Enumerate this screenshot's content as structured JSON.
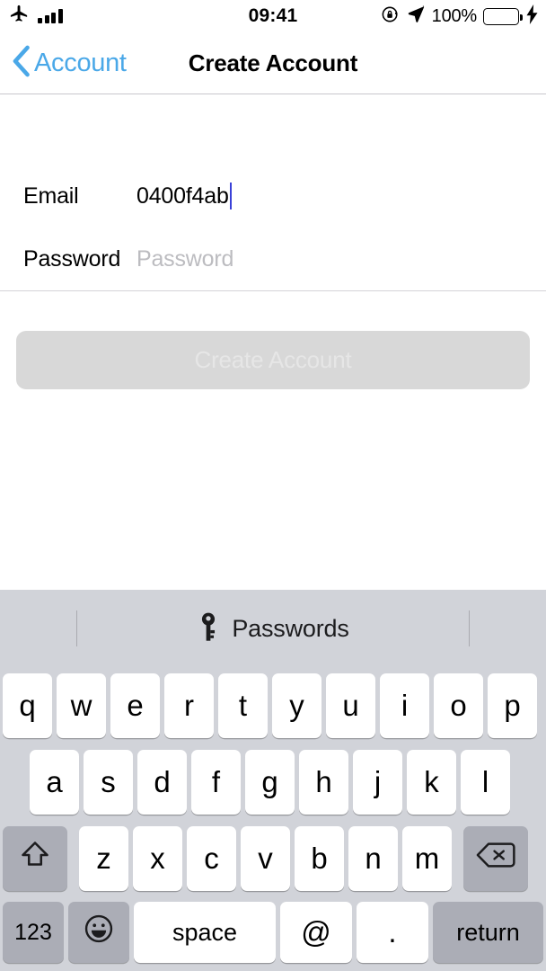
{
  "status_bar": {
    "airplane_icon": "airplane-icon",
    "signal_icon": "signal-bars-icon",
    "time": "09:41",
    "rotation_lock_icon": "rotation-lock-icon",
    "location_icon": "location-arrow-icon",
    "battery_percent": "100%",
    "battery_icon": "battery-icon",
    "charging_icon": "lightning-bolt-icon",
    "battery_color": "#4cd964"
  },
  "nav": {
    "back_label": "Account",
    "back_icon": "chevron-left-icon",
    "title": "Create Account",
    "tint_color": "#4aa8e8"
  },
  "form": {
    "fields": [
      {
        "label": "Email",
        "value": "0400f4ab",
        "placeholder": "",
        "is_placeholder": false,
        "focused": true
      },
      {
        "label": "Password",
        "value": "Password",
        "placeholder": "Password",
        "is_placeholder": true,
        "focused": false
      }
    ],
    "caret_color": "#3a41d8"
  },
  "cta": {
    "label": "Create Account",
    "enabled": false,
    "background": "#d8d8d8",
    "text_color": "#e6e6e6"
  },
  "keyboard": {
    "background": "#d1d3d9",
    "suggestion": {
      "icon": "key-icon",
      "label": "Passwords"
    },
    "row1": [
      "q",
      "w",
      "e",
      "r",
      "t",
      "y",
      "u",
      "i",
      "o",
      "p"
    ],
    "row2": [
      "a",
      "s",
      "d",
      "f",
      "g",
      "h",
      "j",
      "k",
      "l"
    ],
    "row3": {
      "shift_icon": "shift-arrow-icon",
      "letters": [
        "z",
        "x",
        "c",
        "v",
        "b",
        "n",
        "m"
      ],
      "backspace_icon": "backspace-icon"
    },
    "row4": {
      "numbers_label": "123",
      "emoji_icon": "emoji-smiley-icon",
      "space_label": "space",
      "at_label": "@",
      "period_label": ".",
      "return_label": "return"
    }
  }
}
